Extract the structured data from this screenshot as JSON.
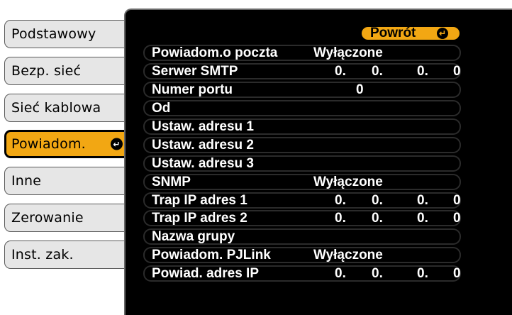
{
  "tabs": [
    {
      "label": "Podstawowy",
      "active": false
    },
    {
      "label": "Bezp. sieć",
      "active": false
    },
    {
      "label": "Sieć kablowa",
      "active": false
    },
    {
      "label": "Powiadom.",
      "active": true
    },
    {
      "label": "Inne",
      "active": false
    },
    {
      "label": "Zerowanie",
      "active": false
    },
    {
      "label": "Inst. zak.",
      "active": false
    }
  ],
  "back_button": {
    "label": "Powrót"
  },
  "rows": [
    {
      "label": "Powiadom.o poczta",
      "value": "Wyłączone"
    },
    {
      "label": "Serwer SMTP",
      "ip": [
        "0.",
        "0.",
        "0.",
        "0"
      ]
    },
    {
      "label": "Numer portu",
      "value": "0"
    },
    {
      "label": "Od"
    },
    {
      "label": "Ustaw. adresu 1"
    },
    {
      "label": "Ustaw. adresu 2"
    },
    {
      "label": "Ustaw. adresu 3"
    },
    {
      "label": "SNMP",
      "value": "Wyłączone"
    },
    {
      "label": "Trap IP adres 1",
      "ip": [
        "0.",
        "0.",
        "0.",
        "0"
      ]
    },
    {
      "label": "Trap IP adres 2",
      "ip": [
        "0.",
        "0.",
        "0.",
        "0"
      ]
    },
    {
      "label": "Nazwa grupy"
    },
    {
      "label": "Powiadom. PJLink",
      "value": "Wyłączone"
    },
    {
      "label": "Powiad. adres IP",
      "ip": [
        "0.",
        "0.",
        "0.",
        "0"
      ]
    }
  ],
  "colors": {
    "accent": "#f2a713",
    "panel": "#000000",
    "tab_bg": "#e6e6e6"
  },
  "icons": {
    "enter": "enter-return-icon"
  }
}
